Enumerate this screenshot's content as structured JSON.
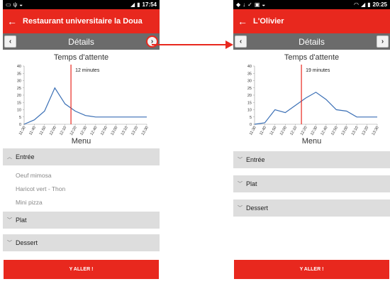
{
  "accent_color": "#e8281e",
  "left": {
    "statusbar": {
      "time": "17:54"
    },
    "appbar": {
      "title": "Restaurant universitaire la Doua"
    },
    "details_title": "Détails",
    "chart_title": "Temps d'attente",
    "menu_title": "Menu",
    "sections": {
      "entree": {
        "label": "Entrée",
        "items": [
          "Oeuf mimosa",
          "Haricot vert - Thon",
          "Mini pizza"
        ]
      },
      "plat": {
        "label": "Plat"
      },
      "dessert": {
        "label": "Dessert"
      }
    },
    "go_button": "Y ALLER !"
  },
  "right": {
    "statusbar": {
      "time": "20:25"
    },
    "appbar": {
      "title": "L'Olivier"
    },
    "details_title": "Détails",
    "chart_title": "Temps d'attente",
    "menu_title": "Menu",
    "sections": {
      "entree": {
        "label": "Entrée"
      },
      "plat": {
        "label": "Plat"
      },
      "dessert": {
        "label": "Dessert"
      }
    },
    "go_button": "Y ALLER !"
  },
  "chart_data": [
    {
      "type": "line",
      "title": "Temps d'attente",
      "x": [
        "11:30",
        "11:40",
        "11:50",
        "12:00",
        "12:10",
        "12:20",
        "12:30",
        "12:40",
        "12:50",
        "13:00",
        "13:10",
        "13:20",
        "13:30"
      ],
      "series": [
        {
          "values": [
            0,
            3,
            9,
            25,
            14,
            9,
            6,
            5,
            5,
            5,
            5,
            5,
            5
          ]
        }
      ],
      "y_ticks": [
        0,
        5,
        10,
        15,
        20,
        25,
        30,
        35,
        40
      ],
      "ylim": [
        0,
        40
      ],
      "marker": {
        "x": "12:20",
        "label": "12 minutes",
        "color": "#e8281e"
      },
      "line_color": "#3a6fb5"
    },
    {
      "type": "line",
      "title": "Temps d'attente",
      "x": [
        "11:30",
        "11:40",
        "11:50",
        "12:00",
        "12:10",
        "12:20",
        "12:30",
        "12:40",
        "12:50",
        "13:00",
        "13:10",
        "13:20",
        "13:30"
      ],
      "series": [
        {
          "values": [
            0,
            1,
            10,
            8,
            13,
            18,
            22,
            17,
            10,
            9,
            5,
            5,
            5
          ]
        }
      ],
      "y_ticks": [
        0,
        5,
        10,
        15,
        20,
        25,
        30,
        35,
        40
      ],
      "ylim": [
        0,
        40
      ],
      "marker": {
        "x": "12:20",
        "label": "19 minutes",
        "color": "#e8281e"
      },
      "line_color": "#3a6fb5"
    }
  ]
}
